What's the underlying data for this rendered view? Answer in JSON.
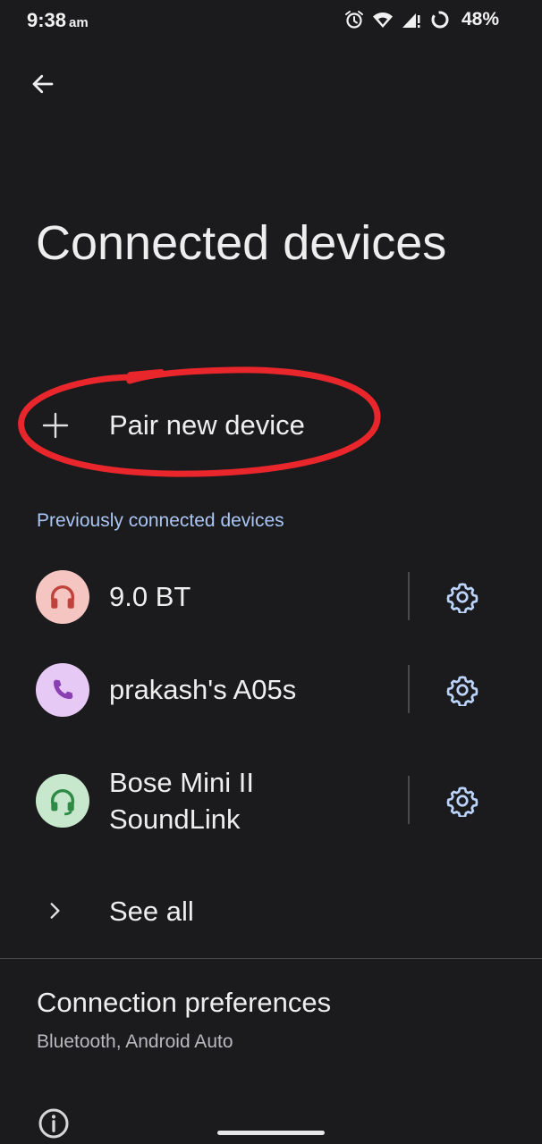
{
  "status_bar": {
    "time": "9:38",
    "ampm": "am",
    "battery": "48%",
    "icons": [
      "alarm-icon",
      "wifi-icon",
      "signal-icon",
      "battery-saver-icon"
    ]
  },
  "header": {
    "back_icon": "arrow-left-icon",
    "title": "Connected devices"
  },
  "pair_device": {
    "icon": "plus-icon",
    "label": "Pair new device",
    "annotation_color": "#e8262b"
  },
  "previous": {
    "header": "Previously connected devices",
    "header_color": "#aac6f4",
    "devices": [
      {
        "name": "9.0 BT",
        "icon": "headphones-icon",
        "avatar_bg": "#f5c6c1",
        "icon_color": "#c0433b",
        "settings_icon": "gear-icon"
      },
      {
        "name": "prakash's A05s",
        "icon": "phone-icon",
        "avatar_bg": "#e6c9f5",
        "icon_color": "#8a3fb2",
        "settings_icon": "gear-icon"
      },
      {
        "name": "Bose Mini II SoundLink",
        "icon": "headset-icon",
        "avatar_bg": "#c7e8cc",
        "icon_color": "#2e8b46",
        "settings_icon": "gear-icon"
      }
    ]
  },
  "see_all": {
    "icon": "chevron-right-icon",
    "label": "See all"
  },
  "preferences": {
    "title": "Connection preferences",
    "subtitle": "Bluetooth, Android Auto"
  },
  "footer": {
    "info_icon": "info-icon"
  }
}
